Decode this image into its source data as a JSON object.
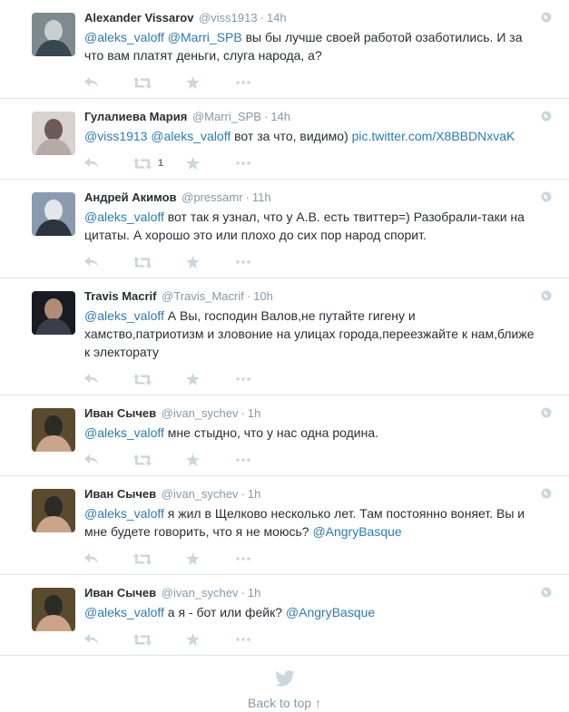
{
  "tweets": [
    {
      "fullname": "Alexander Vissarov",
      "username": "@viss1913",
      "time": "14h",
      "parts": [
        {
          "type": "link",
          "text": "@aleks_valoff"
        },
        {
          "type": "text",
          "text": " "
        },
        {
          "type": "link",
          "text": "@Marri_SPB"
        },
        {
          "type": "text",
          "text": " вы бы лучше своей работой озаботились. И за что вам платят деньги, слуга народа, а?"
        }
      ],
      "retweet_count": ""
    },
    {
      "fullname": "Гулалиева Мария",
      "username": "@Marri_SPB",
      "time": "14h",
      "parts": [
        {
          "type": "link",
          "text": "@viss1913"
        },
        {
          "type": "text",
          "text": " "
        },
        {
          "type": "link",
          "text": "@aleks_valoff"
        },
        {
          "type": "text",
          "text": " вот за что, видимо) "
        },
        {
          "type": "link",
          "text": "pic.twitter.com/X8BBDNxvaK"
        }
      ],
      "retweet_count": "1"
    },
    {
      "fullname": "Андрей Акимов",
      "username": "@pressamr",
      "time": "11h",
      "parts": [
        {
          "type": "link",
          "text": "@aleks_valoff"
        },
        {
          "type": "text",
          "text": "  вот так я узнал, что у А.В. есть твиттер=) Разобрали-таки на цитаты. А хорошо это или плохо до сих пор народ спорит."
        }
      ],
      "retweet_count": ""
    },
    {
      "fullname": "Travis Macrif",
      "username": "@Travis_Macrif",
      "time": "10h",
      "parts": [
        {
          "type": "link",
          "text": "@aleks_valoff"
        },
        {
          "type": "text",
          "text": " А Вы, господин Валов,не путайте гигену и хамство,патриотизм и зловоние на улицах города,переезжайте к нам,ближе к электорату"
        }
      ],
      "retweet_count": ""
    },
    {
      "fullname": "Иван Сычев",
      "username": "@ivan_sychev",
      "time": "1h",
      "parts": [
        {
          "type": "link",
          "text": "@aleks_valoff"
        },
        {
          "type": "text",
          "text": " мне стыдно, что у нас одна родина."
        }
      ],
      "retweet_count": ""
    },
    {
      "fullname": "Иван Сычев",
      "username": "@ivan_sychev",
      "time": "1h",
      "parts": [
        {
          "type": "link",
          "text": "@aleks_valoff"
        },
        {
          "type": "text",
          "text": " я жил в Щелково несколько лет. Там постоянно воняет. Вы и мне будете говорить, что я не моюсь? "
        },
        {
          "type": "link",
          "text": "@AngryBasque"
        }
      ],
      "retweet_count": ""
    },
    {
      "fullname": "Иван Сычев",
      "username": "@ivan_sychev",
      "time": "1h",
      "parts": [
        {
          "type": "link",
          "text": "@aleks_valoff"
        },
        {
          "type": "text",
          "text": " а я - бот или фейк? "
        },
        {
          "type": "link",
          "text": "@AngryBasque"
        }
      ],
      "retweet_count": ""
    }
  ],
  "footer": {
    "back_to_top": "Back to top ↑"
  },
  "icons": {
    "reply": "reply-icon",
    "retweet": "retweet-icon",
    "favorite": "favorite-icon",
    "more": "more-icon",
    "globe": "globe-icon",
    "bird": "twitter-bird-icon"
  },
  "colors": {
    "link": "#2b7bb9",
    "muted": "#8899a6",
    "icon": "#ccd6dd",
    "divider": "#e1e8ed",
    "text": "#292f33"
  }
}
